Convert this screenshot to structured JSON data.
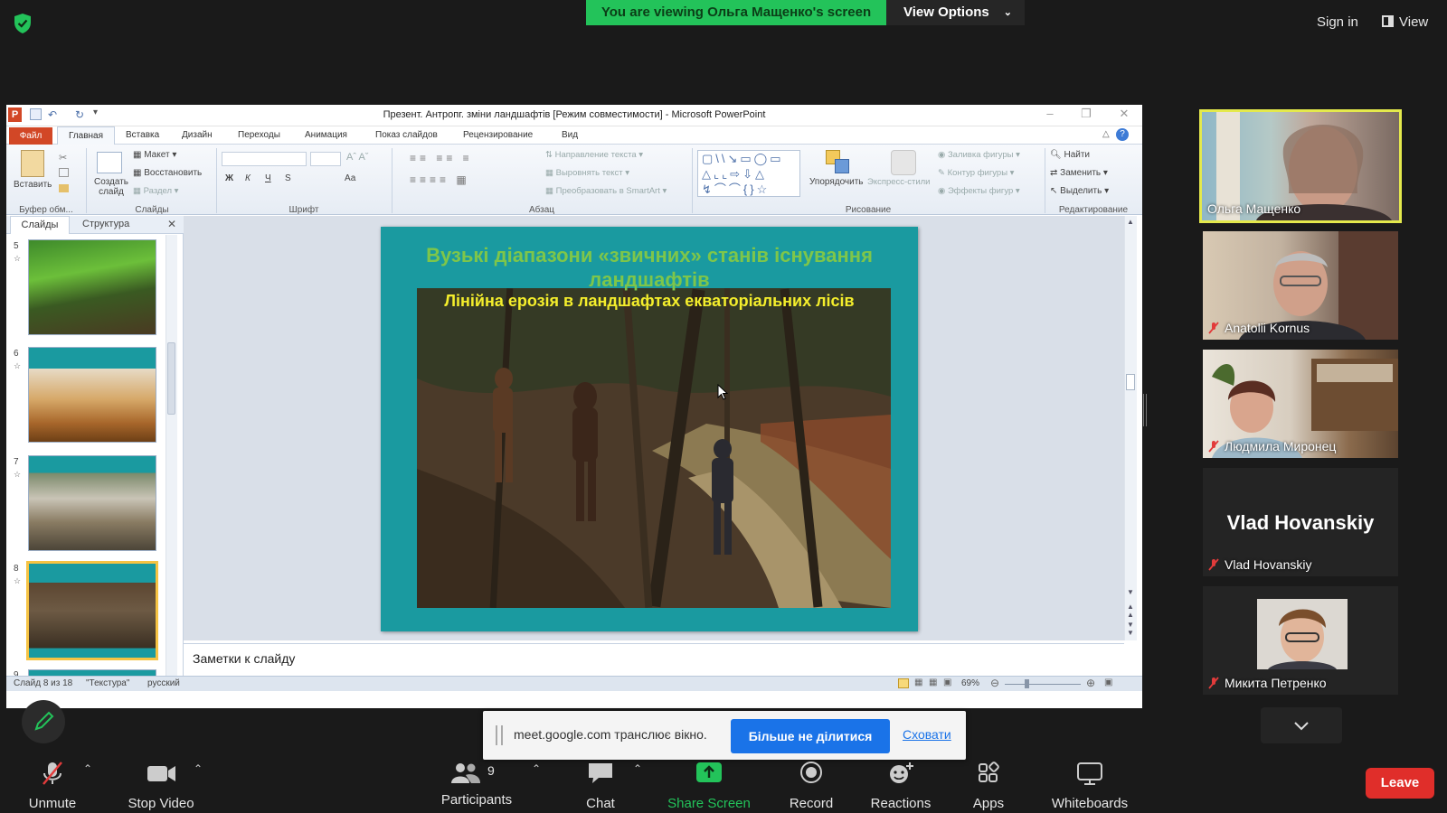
{
  "zoom_top": {
    "banner_text": "You are viewing Ольга Мащенко's screen",
    "view_options": "View Options",
    "sign_in": "Sign in",
    "view": "View"
  },
  "ppt": {
    "title": "Презент. Антропг. зміни ландшафтів [Режим совместимости]  -  Microsoft PowerPoint",
    "tabs": {
      "file": "Файл",
      "home": "Главная",
      "insert": "Вставка",
      "design": "Дизайн",
      "transitions": "Переходы",
      "animation": "Анимация",
      "slideshow": "Показ слайдов",
      "review": "Рецензирование",
      "view": "Вид"
    },
    "ribbon": {
      "paste": "Вставить",
      "clipboard_group": "Буфер обм...",
      "new_slide": "Создать слайд",
      "layout": "Макет",
      "reset": "Восстановить",
      "section": "Раздел",
      "slides_group": "Слайды",
      "font_group": "Шрифт",
      "text_direction": "Направление текста",
      "align_text": "Выровнять текст",
      "smartart": "Преобразовать в SmartArt",
      "paragraph_group": "Абзац",
      "arrange": "Упорядочить",
      "quick_styles": "Экспресс-стили",
      "shape_fill": "Заливка фигуры",
      "shape_outline": "Контур фигуры",
      "shape_effects": "Эффекты фигур",
      "drawing_group": "Рисование",
      "find": "Найти",
      "replace": "Заменить",
      "select": "Выделить",
      "editing_group": "Редактирование",
      "bold": "Ж",
      "italic": "К",
      "underline": "Ч",
      "strike": "S",
      "case": "Аа"
    },
    "left_pane": {
      "tab_slides": "Слайды",
      "tab_outline": "Структура",
      "slides": [
        {
          "num": "5"
        },
        {
          "num": "6"
        },
        {
          "num": "7"
        },
        {
          "num": "8"
        },
        {
          "num": "9"
        }
      ]
    },
    "slide": {
      "title": "Вузькі діапазони «звичних» станів існування ландшафтів",
      "subtitle": "Лінійна ерозія в ландшафтах екваторіальних лісів"
    },
    "notes_placeholder": "Заметки к слайду",
    "status": {
      "slide_info": "Слайд 8 из 18",
      "theme": "\"Текстура\"",
      "language": "русский",
      "zoom": "69%"
    }
  },
  "participants": [
    {
      "name": "Ольга Мащенко",
      "muted": false,
      "active": true
    },
    {
      "name": "Anatolii Kornus",
      "muted": true
    },
    {
      "name": "Людмила Миронец",
      "muted": true
    },
    {
      "name": "Vlad Hovanskiy",
      "muted": true,
      "big_label": "Vlad Hovanskiy"
    },
    {
      "name": "Микита Петренко",
      "muted": true
    }
  ],
  "share_bar": {
    "text": "meet.google.com транслює вікно.",
    "stop": "Більше не ділитися",
    "hide": "Сховати"
  },
  "toolbar": {
    "unmute": "Unmute",
    "stop_video": "Stop Video",
    "participants": "Participants",
    "participants_count": "9",
    "chat": "Chat",
    "share_screen": "Share Screen",
    "record": "Record",
    "reactions": "Reactions",
    "apps": "Apps",
    "whiteboards": "Whiteboards",
    "leave": "Leave"
  },
  "colors": {
    "zoom_green": "#23c35a",
    "leave_red": "#e02e2a",
    "slide_bg": "#1a9aa0",
    "slide_title": "#7ec64a",
    "slide_subtitle": "#f4ee2c",
    "active_speaker": "#e4e94c"
  }
}
